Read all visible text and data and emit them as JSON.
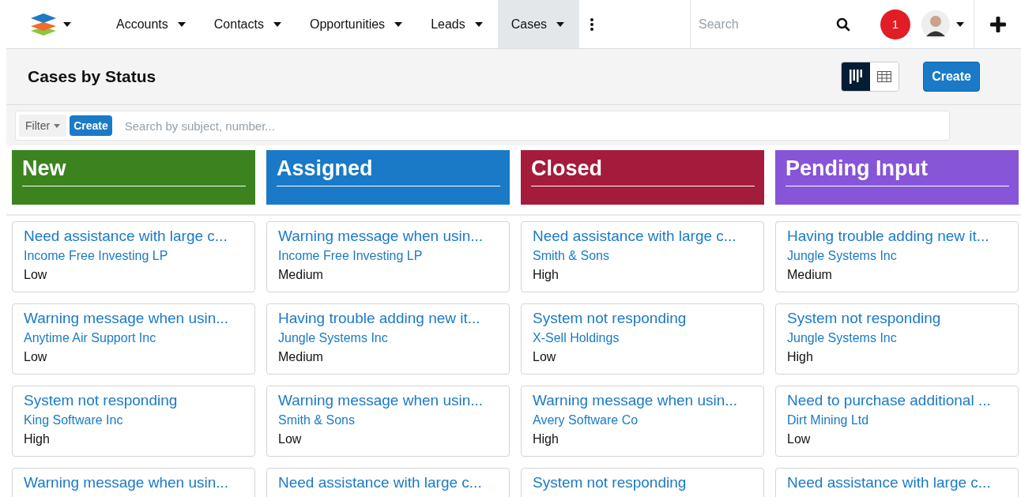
{
  "nav": {
    "tabs": [
      {
        "label": "Accounts",
        "selected": false
      },
      {
        "label": "Contacts",
        "selected": false
      },
      {
        "label": "Opportunities",
        "selected": false
      },
      {
        "label": "Leads",
        "selected": false
      },
      {
        "label": "Cases",
        "selected": true
      }
    ],
    "search": {
      "placeholder": "Search"
    },
    "notifications": "1"
  },
  "header": {
    "title": "Cases by Status",
    "views": [
      {
        "kind": "board",
        "selected": true
      },
      {
        "kind": "list",
        "selected": false
      }
    ],
    "create": "Create"
  },
  "filter": {
    "label": "Filter",
    "create": "Create",
    "placeholder": "Search by subject, number..."
  },
  "columns": [
    {
      "name": "New",
      "color": "#3c8320",
      "cards": [
        {
          "title": "Need assistance with large c...",
          "account": "Income Free Investing LP",
          "priority": "Low"
        },
        {
          "title": "Warning message when usin...",
          "account": "Anytime Air Support Inc",
          "priority": "Low"
        },
        {
          "title": "System not responding",
          "account": "King Software Inc",
          "priority": "High"
        },
        {
          "title": "Warning message when usin..."
        }
      ]
    },
    {
      "name": "Assigned",
      "color": "#1a7ac7",
      "cards": [
        {
          "title": "Warning message when usin...",
          "account": "Income Free Investing LP",
          "priority": "Medium"
        },
        {
          "title": "Having trouble adding new it...",
          "account": "Jungle Systems Inc",
          "priority": "Medium"
        },
        {
          "title": "Warning message when usin...",
          "account": "Smith & Sons",
          "priority": "Low"
        },
        {
          "title": "Need assistance with large c..."
        }
      ]
    },
    {
      "name": "Closed",
      "color": "#a51b3b",
      "cards": [
        {
          "title": "Need assistance with large c...",
          "account": "Smith & Sons",
          "priority": "High"
        },
        {
          "title": "System not responding",
          "account": "X-Sell Holdings",
          "priority": "Low"
        },
        {
          "title": "Warning message when usin...",
          "account": "Avery Software Co",
          "priority": "High"
        },
        {
          "title": "System not responding"
        }
      ]
    },
    {
      "name": "Pending Input",
      "color": "#8655d8",
      "cards": [
        {
          "title": "Having trouble adding new it...",
          "account": "Jungle Systems Inc",
          "priority": "Medium"
        },
        {
          "title": "System not responding",
          "account": "Jungle Systems Inc",
          "priority": "High"
        },
        {
          "title": "Need to purchase additional ...",
          "account": "Dirt Mining Ltd",
          "priority": "Low"
        },
        {
          "title": "Need assistance with large c..."
        }
      ]
    }
  ]
}
